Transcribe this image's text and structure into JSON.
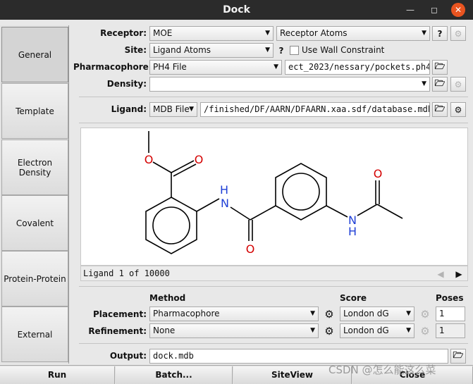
{
  "window": {
    "title": "Dock"
  },
  "sidebar": {
    "tabs": [
      {
        "label": "General"
      },
      {
        "label": "Template"
      },
      {
        "label": "Electron Density"
      },
      {
        "label": "Covalent"
      },
      {
        "label": "Protein-Protein"
      },
      {
        "label": "External"
      }
    ]
  },
  "form": {
    "receptor_label": "Receptor:",
    "receptor_value": "MOE",
    "receptor_atoms_value": "Receptor Atoms",
    "site_label": "Site:",
    "site_value": "Ligand Atoms",
    "wall_label": "Use Wall Constraint",
    "pharm_label": "Pharmacophore:",
    "pharm_value": "PH4 File",
    "pharm_path": "ect_2023/nessary/pockets.ph4",
    "density_label": "Density:",
    "density_value": "",
    "ligand_label": "Ligand:",
    "ligand_value": "MDB File",
    "ligand_path": "/finished/DF/AARN/DFAARN.xaa.sdf/database.mdb",
    "help_label": "?",
    "ligand_status": "Ligand 1 of 10000"
  },
  "molecule": {
    "O": "O",
    "N": "N",
    "H": "H"
  },
  "method_section": {
    "method_header": "Method",
    "score_header": "Score",
    "poses_header": "Poses",
    "placement_label": "Placement:",
    "placement_method": "Pharmacophore",
    "placement_score": "London dG",
    "placement_poses": "1",
    "refinement_label": "Refinement:",
    "refinement_method": "None",
    "refinement_score": "London dG",
    "refinement_poses": "1"
  },
  "output": {
    "label": "Output:",
    "value": "dock.mdb"
  },
  "buttons": {
    "run": "Run",
    "batch": "Batch...",
    "siteview": "SiteView",
    "close": "Close"
  },
  "watermark": "CSDN @怎么能这么菜"
}
